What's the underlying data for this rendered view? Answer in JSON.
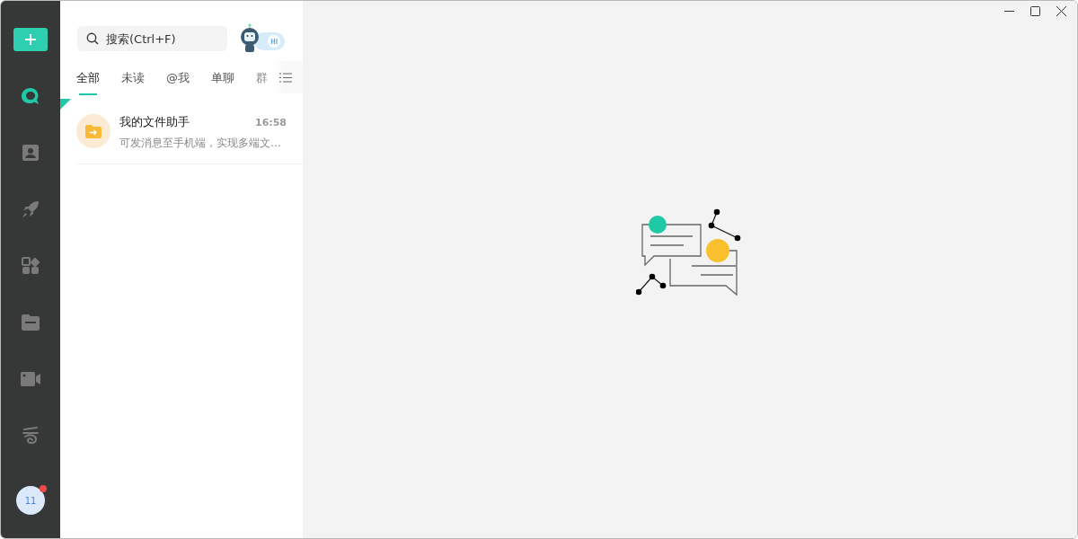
{
  "sidebar": {
    "nav": [
      {
        "kind": "chat",
        "selected": true
      },
      {
        "kind": "contacts",
        "selected": false
      },
      {
        "kind": "rocket",
        "selected": false
      },
      {
        "kind": "apps",
        "selected": false
      },
      {
        "kind": "folder",
        "selected": false
      },
      {
        "kind": "video",
        "selected": false
      },
      {
        "kind": "cloud",
        "selected": false
      }
    ],
    "avatar": {
      "text": "11",
      "unread": true
    }
  },
  "search": {
    "placeholder": "搜索(Ctrl+F)"
  },
  "tabs": [
    {
      "label": "全部",
      "selected": true
    },
    {
      "label": "未读",
      "selected": false
    },
    {
      "label": "@我",
      "selected": false
    },
    {
      "label": "单聊",
      "selected": false
    },
    {
      "label": "群",
      "selected": false
    }
  ],
  "conversations": [
    {
      "name": "我的文件助手",
      "time": "16:58",
      "preview": "可发消息至手机端，实现多端文…",
      "pinned": true
    }
  ]
}
